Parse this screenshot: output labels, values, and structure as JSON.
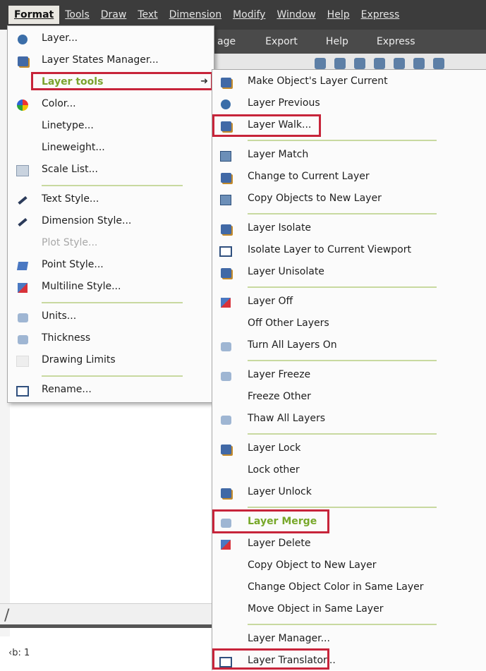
{
  "menubar": {
    "items": [
      "Format",
      "Tools",
      "Draw",
      "Text",
      "Dimension",
      "Modify",
      "Window",
      "Help",
      "Express"
    ]
  },
  "ribbon": {
    "tabs": [
      "age",
      "Export",
      "Help",
      "Express"
    ]
  },
  "status": {
    "text": "‹b: 1"
  },
  "format_menu": {
    "items": [
      {
        "label": "Layer...",
        "icon": "layer-icon"
      },
      {
        "label": "Layer States Manager...",
        "icon": "layer-states-icon"
      },
      {
        "label": "Layer tools",
        "icon": "none",
        "submenu": true
      },
      {
        "label": "Color...",
        "icon": "color-wheel-icon"
      },
      {
        "label": "Linetype...",
        "icon": "none"
      },
      {
        "label": "Lineweight...",
        "icon": "none"
      },
      {
        "label": "Scale List...",
        "icon": "scale-list-icon"
      },
      {
        "label": "Text Style...",
        "icon": "text-style-icon"
      },
      {
        "label": "Dimension Style...",
        "icon": "dimension-style-icon"
      },
      {
        "label": "Plot Style...",
        "icon": "none",
        "disabled": true
      },
      {
        "label": "Point Style...",
        "icon": "point-style-icon"
      },
      {
        "label": "Multiline Style...",
        "icon": "multiline-style-icon"
      },
      {
        "label": "Units...",
        "icon": "units-icon"
      },
      {
        "label": "Thickness",
        "icon": "thickness-icon"
      },
      {
        "label": "Drawing Limits",
        "icon": "drawing-limits-icon"
      },
      {
        "label": "Rename...",
        "icon": "rename-icon"
      }
    ]
  },
  "layer_menu": {
    "items": [
      {
        "label": "Make Object's Layer Current",
        "icon": "make-current-icon"
      },
      {
        "label": "Layer Previous",
        "icon": "layer-previous-icon"
      },
      {
        "label": "Layer Walk...",
        "icon": "layer-walk-icon",
        "highlight": true
      },
      {
        "label": "Layer Match",
        "icon": "layer-match-icon"
      },
      {
        "label": "Change to Current Layer",
        "icon": "change-current-icon"
      },
      {
        "label": "Copy Objects to New Layer",
        "icon": "copy-objects-icon"
      },
      {
        "label": "Layer Isolate",
        "icon": "layer-isolate-icon"
      },
      {
        "label": "Isolate Layer to Current Viewport",
        "icon": "isolate-viewport-icon"
      },
      {
        "label": "Layer Unisolate",
        "icon": "layer-unisolate-icon"
      },
      {
        "label": "Layer Off",
        "icon": "layer-off-icon"
      },
      {
        "label": "Off Other Layers",
        "icon": "none"
      },
      {
        "label": "Turn All Layers On",
        "icon": "layers-on-icon"
      },
      {
        "label": "Layer Freeze",
        "icon": "layer-freeze-icon"
      },
      {
        "label": "Freeze Other",
        "icon": "none"
      },
      {
        "label": "Thaw All Layers",
        "icon": "thaw-layers-icon"
      },
      {
        "label": "Layer Lock",
        "icon": "layer-lock-icon"
      },
      {
        "label": "Lock other",
        "icon": "none"
      },
      {
        "label": "Layer Unlock",
        "icon": "layer-unlock-icon"
      },
      {
        "label": "Layer Merge",
        "icon": "layer-merge-icon",
        "highlight": true,
        "green": true
      },
      {
        "label": "Layer Delete",
        "icon": "layer-delete-icon"
      },
      {
        "label": "Copy Object to New Layer",
        "icon": "none"
      },
      {
        "label": "Change Object Color in Same Layer",
        "icon": "none"
      },
      {
        "label": "Move Object in Same Layer",
        "icon": "none"
      },
      {
        "label": "Layer Manager...",
        "icon": "none"
      },
      {
        "label": "Layer Translator...",
        "icon": "layer-translator-icon",
        "highlight": true
      }
    ]
  },
  "colors": {
    "highlight_border": "#c7243a",
    "separator": "#c8d9a0",
    "active_label": "#78a82a"
  }
}
